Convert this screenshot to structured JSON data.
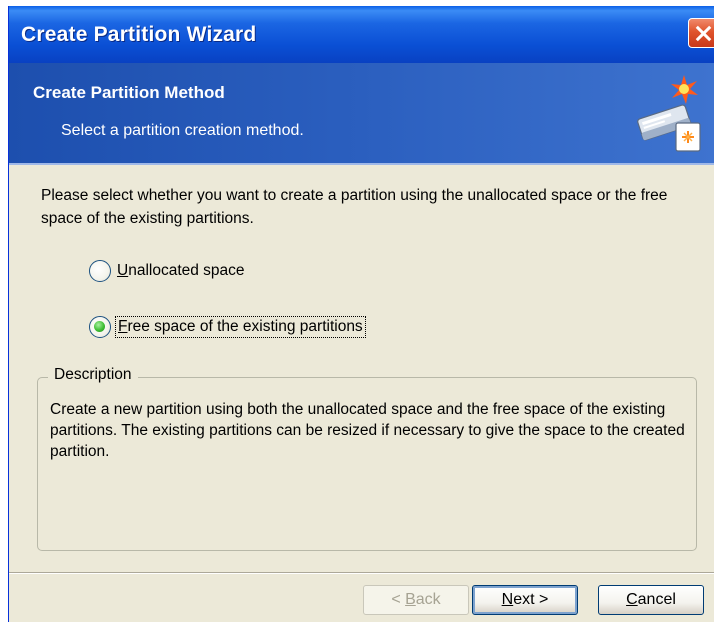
{
  "window": {
    "title": "Create Partition Wizard"
  },
  "header": {
    "title": "Create Partition Method",
    "subtitle": "Select a partition creation method."
  },
  "content": {
    "intro": "Please select whether you want to create a partition using the unallocated space or the free space of the existing partitions.",
    "options": [
      {
        "accel": "U",
        "rest": "nallocated space",
        "selected": false
      },
      {
        "accel": "F",
        "rest": "ree space of the existing partitions",
        "selected": true
      }
    ]
  },
  "description": {
    "legend": "Description",
    "text": "Create a new partition using both the unallocated space and the free space of the existing partitions. The existing partitions can be resized if necessary to give the space to the created partition."
  },
  "buttons": {
    "back_prefix": "< ",
    "back_accel": "B",
    "back_rest": "ack",
    "next_accel": "N",
    "next_rest": "ext >",
    "cancel_accel": "C",
    "cancel_rest": "ancel"
  },
  "colors": {
    "title_bar": "#0a4fd4",
    "header_band": "#2b5fbf",
    "dialog_bg": "#ece9d8",
    "close_button": "#e0542c",
    "radio_selected": "#3fbf34"
  },
  "icons": {
    "close": "close-icon",
    "wizard": "wizard-disk-icon"
  }
}
